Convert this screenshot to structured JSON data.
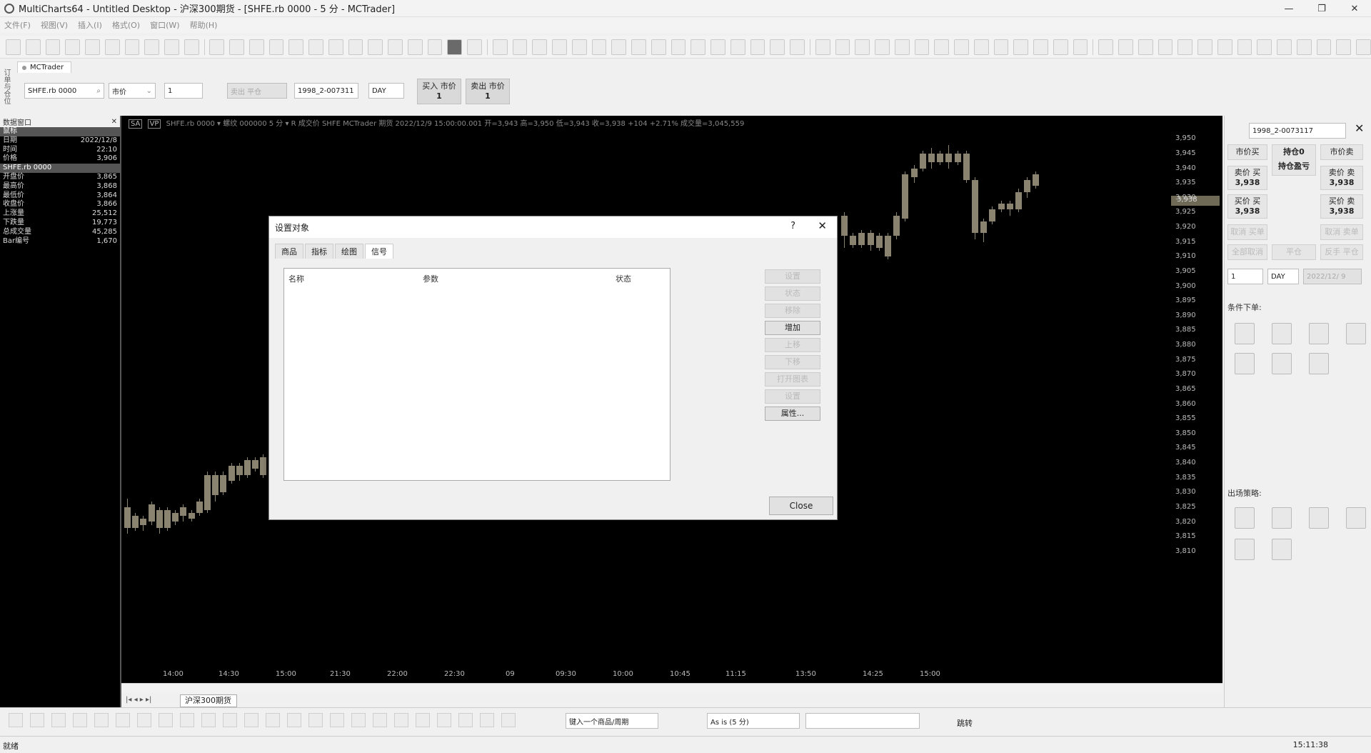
{
  "window": {
    "title": "MultiCharts64 - Untitled Desktop - 沪深300期货 - [SHFE.rb 0000 - 5 分 - MCTrader]",
    "controls": [
      "—",
      "❐",
      "✕"
    ]
  },
  "menu": {
    "items": [
      "文件(F)",
      "视图(V)",
      "插入(I)",
      "格式(O)",
      "窗口(W)",
      "帮助(H)"
    ]
  },
  "left_vertical_tab": "订单与仓位",
  "trade_tab": {
    "label": "MCTrader"
  },
  "trade_bar": {
    "symbol": "SHFE.rb 0000",
    "order_type": "市价",
    "quantity": "1",
    "position_mode": "卖出 平仓",
    "account": "1998_2-007311",
    "tif": "DAY",
    "buy_label": "买入 市价",
    "buy_qty": "1",
    "sell_label": "卖出 市价",
    "sell_qty": "1"
  },
  "data_window": {
    "title": "数据窗口",
    "section1": "鼠标",
    "rows1": [
      {
        "k": "日期",
        "v": "2022/12/8"
      },
      {
        "k": "时间",
        "v": "22:10"
      },
      {
        "k": "价格",
        "v": "3,906"
      }
    ],
    "section2": "SHFE.rb 0000",
    "rows2": [
      {
        "k": "开盘价",
        "v": "3,865"
      },
      {
        "k": "最高价",
        "v": "3,868"
      },
      {
        "k": "最低价",
        "v": "3,864"
      },
      {
        "k": "收盘价",
        "v": "3,866"
      },
      {
        "k": "上涨量",
        "v": "25,512"
      },
      {
        "k": "下跌量",
        "v": "19,773"
      },
      {
        "k": "总成交量",
        "v": "45,285"
      },
      {
        "k": "Bar编号",
        "v": "1,670"
      }
    ]
  },
  "chart": {
    "info_sa": "SA",
    "info_vp": "VP",
    "info_line": "SHFE.rb 0000 ▾ 螺纹 000000 5 分 ▾ R 成交价 SHFE MCTrader 期货 2022/12/9 15:00:00.001 开=3,943 高=3,950 低=3,943 收=3,938 +104 +2.71% 成交量=3,045,559",
    "last_price": "3,938",
    "price_ticks": [
      "3,950",
      "3,945",
      "3,940",
      "3,935",
      "3,930",
      "3,925",
      "3,920",
      "3,915",
      "3,910",
      "3,905",
      "3,900",
      "3,895",
      "3,890",
      "3,885",
      "3,880",
      "3,875",
      "3,870",
      "3,865",
      "3,860",
      "3,855",
      "3,850",
      "3,845",
      "3,840",
      "3,835",
      "3,830",
      "3,825",
      "3,820",
      "3,815",
      "3,810"
    ],
    "time_ticks": [
      "14:00",
      "14:30",
      "15:00",
      "21:30",
      "22:00",
      "22:30",
      "09",
      "09:30",
      "10:00",
      "10:45",
      "11:15",
      "13:50",
      "14:25",
      "15:00"
    ],
    "sheet_tab": "沪深300期货"
  },
  "chart_data": {
    "type": "candlestick",
    "ylim": [
      3808,
      3953
    ],
    "candles_left": [
      {
        "o": 3825,
        "c": 3818,
        "h": 3828,
        "l": 3816
      },
      {
        "o": 3818,
        "c": 3822,
        "h": 3823,
        "l": 3817
      },
      {
        "o": 3819,
        "c": 3821,
        "h": 3822,
        "l": 3817
      },
      {
        "o": 3820,
        "c": 3826,
        "h": 3827,
        "l": 3819
      },
      {
        "o": 3824,
        "c": 3818,
        "h": 3825,
        "l": 3816
      },
      {
        "o": 3818,
        "c": 3824,
        "h": 3825,
        "l": 3817
      },
      {
        "o": 3823,
        "c": 3820,
        "h": 3824,
        "l": 3819
      },
      {
        "o": 3822,
        "c": 3825,
        "h": 3826,
        "l": 3820
      },
      {
        "o": 3823,
        "c": 3821,
        "h": 3824,
        "l": 3820
      },
      {
        "o": 3823,
        "c": 3827,
        "h": 3828,
        "l": 3822
      },
      {
        "o": 3824,
        "c": 3836,
        "h": 3837,
        "l": 3823
      },
      {
        "o": 3829,
        "c": 3836,
        "h": 3837,
        "l": 3827
      },
      {
        "o": 3830,
        "c": 3836,
        "h": 3837,
        "l": 3829
      },
      {
        "o": 3834,
        "c": 3839,
        "h": 3840,
        "l": 3833
      },
      {
        "o": 3836,
        "c": 3839,
        "h": 3840,
        "l": 3834
      },
      {
        "o": 3836,
        "c": 3841,
        "h": 3842,
        "l": 3835
      },
      {
        "o": 3838,
        "c": 3841,
        "h": 3842,
        "l": 3837
      },
      {
        "o": 3836,
        "c": 3842,
        "h": 3843,
        "l": 3835
      },
      {
        "o": 3842,
        "c": 3856,
        "h": 3858,
        "l": 3841
      }
    ],
    "candles_right": [
      {
        "o": 3924,
        "c": 3917,
        "h": 3925,
        "l": 3913
      },
      {
        "o": 3917,
        "c": 3914,
        "h": 3918,
        "l": 3913
      },
      {
        "o": 3914,
        "c": 3918,
        "h": 3919,
        "l": 3913
      },
      {
        "o": 3914,
        "c": 3918,
        "h": 3919,
        "l": 3912
      },
      {
        "o": 3913,
        "c": 3917,
        "h": 3918,
        "l": 3912
      },
      {
        "o": 3917,
        "c": 3910,
        "h": 3918,
        "l": 3909
      },
      {
        "o": 3917,
        "c": 3924,
        "h": 3925,
        "l": 3916
      },
      {
        "o": 3923,
        "c": 3938,
        "h": 3939,
        "l": 3922
      },
      {
        "o": 3937,
        "c": 3940,
        "h": 3941,
        "l": 3935
      },
      {
        "o": 3940,
        "c": 3945,
        "h": 3946,
        "l": 3939
      },
      {
        "o": 3945,
        "c": 3942,
        "h": 3947,
        "l": 3940
      },
      {
        "o": 3942,
        "c": 3945,
        "h": 3946,
        "l": 3941
      },
      {
        "o": 3945,
        "c": 3942,
        "h": 3948,
        "l": 3940
      },
      {
        "o": 3942,
        "c": 3945,
        "h": 3946,
        "l": 3941
      },
      {
        "o": 3945,
        "c": 3936,
        "h": 3946,
        "l": 3935
      },
      {
        "o": 3936,
        "c": 3918,
        "h": 3937,
        "l": 3916
      },
      {
        "o": 3918,
        "c": 3922,
        "h": 3923,
        "l": 3915
      },
      {
        "o": 3922,
        "c": 3926,
        "h": 3927,
        "l": 3921
      },
      {
        "o": 3926,
        "c": 3928,
        "h": 3929,
        "l": 3925
      },
      {
        "o": 3928,
        "c": 3926,
        "h": 3929,
        "l": 3924
      },
      {
        "o": 3926,
        "c": 3932,
        "h": 3933,
        "l": 3925
      },
      {
        "o": 3932,
        "c": 3936,
        "h": 3937,
        "l": 3930
      },
      {
        "o": 3934,
        "c": 3938,
        "h": 3939,
        "l": 3933
      }
    ]
  },
  "right_panel": {
    "account": "1998_2-0073117",
    "market_buy": "市价买",
    "position": "持仓0",
    "position_pnl": "持仓盈亏",
    "market_sell": "市价卖",
    "ask_buy": "卖价 买",
    "ask_buy_val": "3,938",
    "ask_sell": "卖价 卖",
    "ask_sell_val": "3,938",
    "bid_buy": "买价 买",
    "bid_buy_val": "3,938",
    "bid_sell": "买价 卖",
    "bid_sell_val": "3,938",
    "gray1": "取消 买单",
    "gray2": "取消 卖单",
    "gray3": "全部取消",
    "gray4": "平仓",
    "gray5": "反手 平仓",
    "qty": "1",
    "tif": "DAY",
    "date": "2022/12/ 9",
    "conditional_title": "条件下单:",
    "exit_title": "出场策略:"
  },
  "bottom_bar": {
    "symbol_input": "键入一个商品/周期",
    "resolution": "As is (5 分)",
    "jump": "跳转"
  },
  "status": {
    "left": "就绪",
    "clock": "15:11:38"
  },
  "dialog": {
    "title": "设置对象",
    "help": "?",
    "close_x": "✕",
    "tabs": [
      "商品",
      "指标",
      "绘图",
      "信号"
    ],
    "columns": [
      "名称",
      "参数",
      "状态"
    ],
    "buttons": [
      "设置",
      "状态",
      "移除",
      "增加",
      "上移",
      "下移",
      "打开图表",
      "设置",
      "属性..."
    ],
    "close": "Close"
  }
}
